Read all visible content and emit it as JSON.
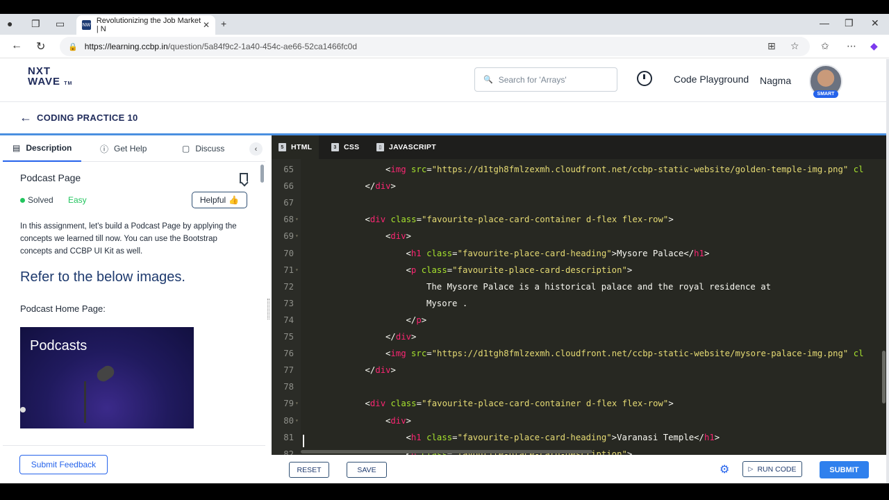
{
  "browser": {
    "tab_title": "Revolutionizing the Job Market | N",
    "tab_favicon": "NW",
    "url_host": "https://learning.ccbp.in",
    "url_path": "/question/5a84f9c2-1a40-454c-ae66-52ca1466fc0d"
  },
  "header": {
    "logo_line1": "NXT",
    "logo_line2": "WAVE",
    "logo_tm": "TM",
    "search_placeholder": "Search for 'Arrays'",
    "playground_label": "Code Playground",
    "username": "Nagma",
    "avatar_badge": "SMART"
  },
  "subheader": {
    "title": "CODING PRACTICE 10"
  },
  "left_panel": {
    "tabs": [
      {
        "label": "Description",
        "icon": "document-icon"
      },
      {
        "label": "Get Help",
        "icon": "help-circle-icon"
      },
      {
        "label": "Discuss",
        "icon": "chat-icon"
      }
    ],
    "problem_title": "Podcast Page",
    "status": "Solved",
    "difficulty": "Easy",
    "helpful_label": "Helpful",
    "description": "In this assignment, let's build a Podcast Page by applying the concepts we learned till now. You can use the Bootstrap concepts and CCBP UI Kit as well.",
    "refer_heading": "Refer to the below images.",
    "home_page_heading": "Podcast Home Page:",
    "image_text": "Podcasts",
    "feedback_button": "Submit Feedback"
  },
  "editor": {
    "tabs": [
      {
        "label": "HTML",
        "icon": "html5-icon"
      },
      {
        "label": "CSS",
        "icon": "css3-icon"
      },
      {
        "label": "JAVASCRIPT",
        "icon": "js-file-icon"
      }
    ],
    "lines": [
      {
        "n": "65",
        "fold": false,
        "indent": 4,
        "segs": [
          [
            "pn",
            "<"
          ],
          [
            "tg",
            "img"
          ],
          [
            "pn",
            " "
          ],
          [
            "at",
            "src"
          ],
          [
            "pn",
            "="
          ],
          [
            "st",
            "\"https://d1tgh8fmlzexmh.cloudfront.net/ccbp-static-website/golden-temple-img.png\""
          ],
          [
            "pn",
            " "
          ],
          [
            "at",
            "cl"
          ]
        ]
      },
      {
        "n": "66",
        "fold": false,
        "indent": 3,
        "segs": [
          [
            "pn",
            "</"
          ],
          [
            "tg",
            "div"
          ],
          [
            "pn",
            ">"
          ]
        ]
      },
      {
        "n": "67",
        "fold": false,
        "indent": 0,
        "segs": []
      },
      {
        "n": "68",
        "fold": true,
        "indent": 3,
        "segs": [
          [
            "pn",
            "<"
          ],
          [
            "tg",
            "div"
          ],
          [
            "pn",
            " "
          ],
          [
            "at",
            "class"
          ],
          [
            "pn",
            "="
          ],
          [
            "st",
            "\"favourite-place-card-container d-flex flex-row\""
          ],
          [
            "pn",
            ">"
          ]
        ]
      },
      {
        "n": "69",
        "fold": true,
        "indent": 4,
        "segs": [
          [
            "pn",
            "<"
          ],
          [
            "tg",
            "div"
          ],
          [
            "pn",
            ">"
          ]
        ]
      },
      {
        "n": "70",
        "fold": false,
        "indent": 5,
        "segs": [
          [
            "pn",
            "<"
          ],
          [
            "tg",
            "h1"
          ],
          [
            "pn",
            " "
          ],
          [
            "at",
            "class"
          ],
          [
            "pn",
            "="
          ],
          [
            "st",
            "\"favourite-place-card-heading\""
          ],
          [
            "pn",
            ">Mysore Palace</"
          ],
          [
            "tg",
            "h1"
          ],
          [
            "pn",
            ">"
          ]
        ]
      },
      {
        "n": "71",
        "fold": true,
        "indent": 5,
        "segs": [
          [
            "pn",
            "<"
          ],
          [
            "tg",
            "p"
          ],
          [
            "pn",
            " "
          ],
          [
            "at",
            "class"
          ],
          [
            "pn",
            "="
          ],
          [
            "st",
            "\"favourite-place-card-description\""
          ],
          [
            "pn",
            ">"
          ]
        ]
      },
      {
        "n": "72",
        "fold": false,
        "indent": 6,
        "segs": [
          [
            "pn",
            "The Mysore Palace is a historical palace and the royal residence at"
          ]
        ]
      },
      {
        "n": "73",
        "fold": false,
        "indent": 6,
        "segs": [
          [
            "pn",
            "Mysore ."
          ]
        ]
      },
      {
        "n": "74",
        "fold": false,
        "indent": 5,
        "segs": [
          [
            "pn",
            "</"
          ],
          [
            "tg",
            "p"
          ],
          [
            "pn",
            ">"
          ]
        ]
      },
      {
        "n": "75",
        "fold": false,
        "indent": 4,
        "segs": [
          [
            "pn",
            "</"
          ],
          [
            "tg",
            "div"
          ],
          [
            "pn",
            ">"
          ]
        ]
      },
      {
        "n": "76",
        "fold": false,
        "indent": 4,
        "segs": [
          [
            "pn",
            "<"
          ],
          [
            "tg",
            "img"
          ],
          [
            "pn",
            " "
          ],
          [
            "at",
            "src"
          ],
          [
            "pn",
            "="
          ],
          [
            "st",
            "\"https://d1tgh8fmlzexmh.cloudfront.net/ccbp-static-website/mysore-palace-img.png\""
          ],
          [
            "pn",
            " "
          ],
          [
            "at",
            "cl"
          ]
        ]
      },
      {
        "n": "77",
        "fold": false,
        "indent": 3,
        "segs": [
          [
            "pn",
            "</"
          ],
          [
            "tg",
            "div"
          ],
          [
            "pn",
            ">"
          ]
        ]
      },
      {
        "n": "78",
        "fold": false,
        "indent": 0,
        "segs": []
      },
      {
        "n": "79",
        "fold": true,
        "indent": 3,
        "segs": [
          [
            "pn",
            "<"
          ],
          [
            "tg",
            "div"
          ],
          [
            "pn",
            " "
          ],
          [
            "at",
            "class"
          ],
          [
            "pn",
            "="
          ],
          [
            "st",
            "\"favourite-place-card-container d-flex flex-row\""
          ],
          [
            "pn",
            ">"
          ]
        ]
      },
      {
        "n": "80",
        "fold": true,
        "indent": 4,
        "segs": [
          [
            "pn",
            "<"
          ],
          [
            "tg",
            "div"
          ],
          [
            "pn",
            ">"
          ]
        ]
      },
      {
        "n": "81",
        "fold": false,
        "indent": 5,
        "segs": [
          [
            "pn",
            "<"
          ],
          [
            "tg",
            "h1"
          ],
          [
            "pn",
            " "
          ],
          [
            "at",
            "class"
          ],
          [
            "pn",
            "="
          ],
          [
            "st",
            "\"favourite-place-card-heading\""
          ],
          [
            "pn",
            ">Varanasi Temple</"
          ],
          [
            "tg",
            "h1"
          ],
          [
            "pn",
            ">"
          ]
        ]
      },
      {
        "n": "82",
        "fold": false,
        "indent": 5,
        "segs": [
          [
            "pn",
            "<"
          ],
          [
            "tg",
            "p"
          ],
          [
            "pn",
            " "
          ],
          [
            "at",
            "class"
          ],
          [
            "pn",
            "="
          ],
          [
            "st",
            "\"favourite-place-card-description\""
          ],
          [
            "pn",
            ">"
          ]
        ]
      }
    ]
  },
  "actions": {
    "reset": "RESET",
    "save": "SAVE",
    "run": "RUN CODE",
    "submit": "SUBMIT"
  },
  "colors": {
    "accent": "#2f80ed",
    "brand_navy": "#1e2a5a",
    "editor_bg": "#272822",
    "solved_green": "#22c55e"
  }
}
